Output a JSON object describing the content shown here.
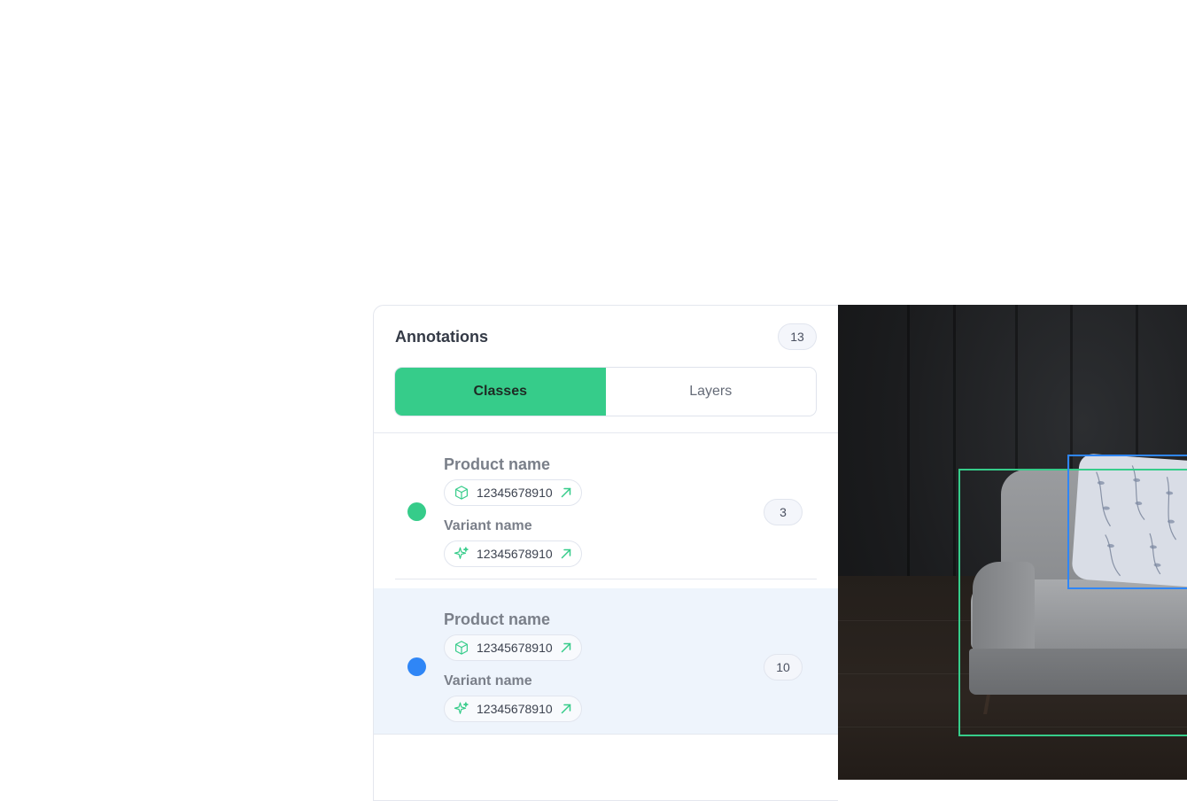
{
  "panel": {
    "title": "Annotations",
    "total_count": "13",
    "tabs": [
      {
        "label": "Classes",
        "active": true
      },
      {
        "label": "Layers",
        "active": false
      }
    ]
  },
  "classes": [
    {
      "color": "#36cc8a",
      "product_name": "Product name",
      "product_id": "12345678910",
      "product_icon": "cube-icon",
      "variant_name": "Variant name",
      "variant_id": "12345678910",
      "variant_icon": "sparkle-icon",
      "count": "3",
      "selected": false
    },
    {
      "color": "#2f86f6",
      "product_name": "Product name",
      "product_id": "12345678910",
      "product_icon": "cube-icon",
      "variant_name": "Variant name",
      "variant_id": "12345678910",
      "variant_icon": "sparkle-icon",
      "count": "10",
      "selected": true
    }
  ],
  "colors": {
    "accent_green": "#36cc8a",
    "accent_blue": "#2f86f6",
    "selected_row_bg": "#eef4fc"
  }
}
